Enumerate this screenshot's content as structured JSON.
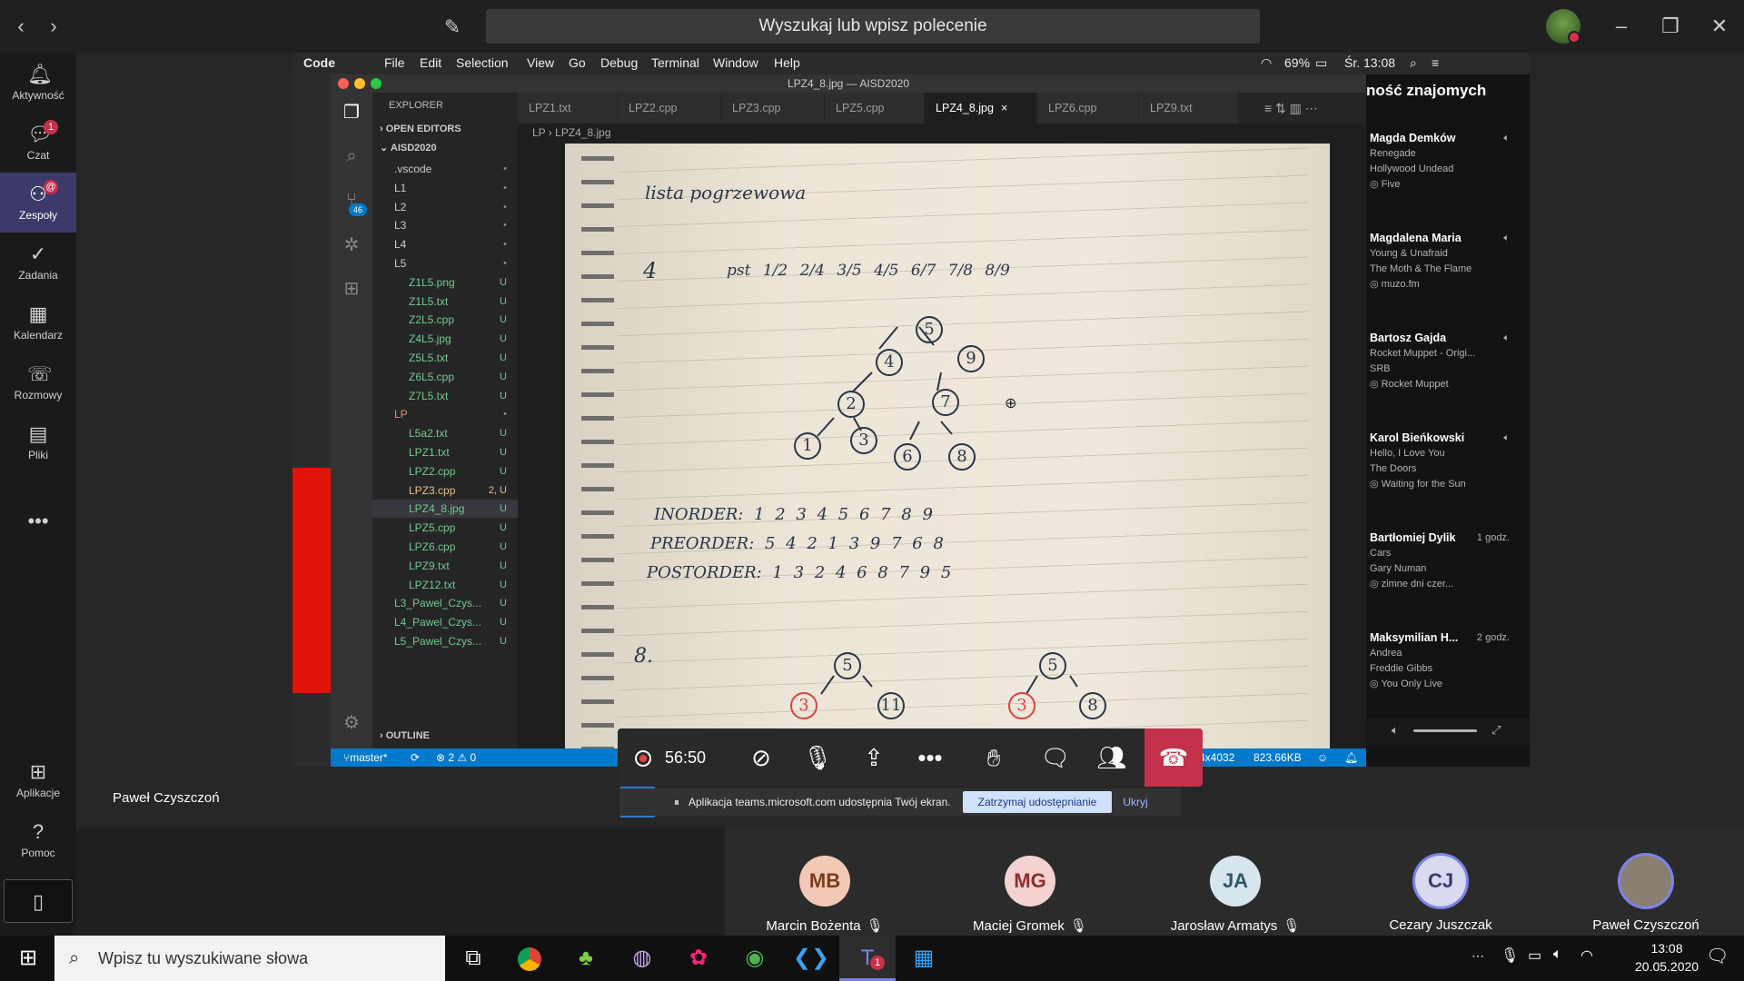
{
  "teams": {
    "search_placeholder": "Wyszukaj lub wpisz polecenie",
    "rail": [
      {
        "label": "Aktywność",
        "icon": "bell-icon"
      },
      {
        "label": "Czat",
        "icon": "chat-icon",
        "badge": "1"
      },
      {
        "label": "Zespoły",
        "icon": "teams-icon",
        "badge": "@"
      },
      {
        "label": "Zadania",
        "icon": "tasks-icon"
      },
      {
        "label": "Kalendarz",
        "icon": "calendar-icon"
      },
      {
        "label": "Rozmowy",
        "icon": "phone-icon"
      },
      {
        "label": "Pliki",
        "icon": "files-icon"
      },
      {
        "label": "Aplikacje",
        "icon": "apps-icon"
      },
      {
        "label": "Pomoc",
        "icon": "help-icon"
      }
    ]
  },
  "mac_menu": {
    "items": [
      "Code",
      "File",
      "Edit",
      "Selection",
      "View",
      "Go",
      "Debug",
      "Terminal",
      "Window",
      "Help"
    ],
    "battery": "69%",
    "clock": "Śr. 13:08"
  },
  "vscode": {
    "window_title": "LPZ4_8.jpg — AISD2020",
    "explorer_title": "EXPLORER",
    "open_editors": "OPEN EDITORS",
    "project": "AISD2020",
    "outline": "OUTLINE",
    "scm_badge": "46",
    "tree": [
      {
        "name": ".vscode",
        "status": "•",
        "indent": 1
      },
      {
        "name": "L1",
        "status": "•",
        "indent": 1
      },
      {
        "name": "L2",
        "status": "•",
        "indent": 1
      },
      {
        "name": "L3",
        "status": "•",
        "indent": 1
      },
      {
        "name": "L4",
        "status": "•",
        "indent": 1
      },
      {
        "name": "L5",
        "status": "•",
        "indent": 1
      },
      {
        "name": "Z1L5.png",
        "status": "U",
        "indent": 2
      },
      {
        "name": "Z1L5.txt",
        "status": "U",
        "indent": 2
      },
      {
        "name": "Z2L5.cpp",
        "status": "U",
        "indent": 2
      },
      {
        "name": "Z4L5.jpg",
        "status": "U",
        "indent": 2
      },
      {
        "name": "Z5L5.txt",
        "status": "U",
        "indent": 2
      },
      {
        "name": "Z6L5.cpp",
        "status": "U",
        "indent": 2
      },
      {
        "name": "Z7L5.txt",
        "status": "U",
        "indent": 2
      },
      {
        "name": "LP",
        "status": "•",
        "indent": 1
      },
      {
        "name": "L5a2.txt",
        "status": "U",
        "indent": 2
      },
      {
        "name": "LPZ1.txt",
        "status": "U",
        "indent": 2
      },
      {
        "name": "LPZ2.cpp",
        "status": "U",
        "indent": 2
      },
      {
        "name": "LPZ3.cpp",
        "status": "2, U",
        "indent": 2
      },
      {
        "name": "LPZ4_8.jpg",
        "status": "U",
        "indent": 2
      },
      {
        "name": "LPZ5.cpp",
        "status": "U",
        "indent": 2
      },
      {
        "name": "LPZ6.cpp",
        "status": "U",
        "indent": 2
      },
      {
        "name": "LPZ9.txt",
        "status": "U",
        "indent": 2
      },
      {
        "name": "LPZ12.txt",
        "status": "U",
        "indent": 2
      },
      {
        "name": "L3_Pawel_Czys...",
        "status": "U",
        "indent": 1
      },
      {
        "name": "L4_Pawel_Czys...",
        "status": "U",
        "indent": 1
      },
      {
        "name": "L5_Pawel_Czys...",
        "status": "U",
        "indent": 1
      }
    ],
    "tabs": [
      "LPZ1.txt",
      "LPZ2.cpp",
      "LPZ3.cpp",
      "LPZ5.cpp",
      "LPZ4_8.jpg",
      "LPZ6.cpp",
      "LPZ9.txt"
    ],
    "breadcrumb": [
      "LP",
      "LPZ4_8.jpg"
    ],
    "status": {
      "branch": "master*",
      "problems": "⊗ 2 ⚠ 0",
      "dims": "4x4032",
      "size": "823.66KB"
    }
  },
  "notes": {
    "title": "lista pogrzewowa",
    "label4": "4",
    "row4": "pst  1/2  2/4  3/5  4/5  6/7  7/8  8/9",
    "inorder": "INORDER:   1 2 3 4 5 6 7 8 9",
    "preorder": "PREORDER:   5 4 2 1 3 9 7 6 8",
    "postorder": "POSTORDER:   1 3 2 4 6 8 7 9 5",
    "label8": "8.",
    "tree_nodes": [
      "5",
      "4",
      "9",
      "2",
      "7",
      "1",
      "3",
      "6",
      "8"
    ],
    "tree2_nodes": [
      "5",
      "3",
      "11"
    ],
    "tree3_nodes": [
      "5",
      "3",
      "8"
    ]
  },
  "spotify": {
    "title": "ność znajomych",
    "friends": [
      {
        "name": "Magda Demków",
        "song": "Renegade",
        "artist": "Hollywood Undead",
        "ctx": "Five",
        "time": ""
      },
      {
        "name": "Magdalena Maria",
        "song": "Young & Unafraid",
        "artist": "The Moth & The Flame",
        "ctx": "muzo.fm",
        "time": ""
      },
      {
        "name": "Bartosz Gajda",
        "song": "Rocket Muppet - Origi...",
        "artist": "SRB",
        "ctx": "Rocket Muppet",
        "time": ""
      },
      {
        "name": "Karol Bieńkowski",
        "song": "Hello, I Love You",
        "artist": "The Doors",
        "ctx": "Waiting for the Sun",
        "time": ""
      },
      {
        "name": "Bartłomiej Dylik",
        "song": "Cars",
        "artist": "Gary Numan",
        "ctx": "zimne dni czer...",
        "time": "1 godz."
      },
      {
        "name": "Maksymilian H...",
        "song": "Andrea",
        "artist": "Freddie Gibbs",
        "ctx": "You Only Live",
        "time": "2 godz."
      }
    ]
  },
  "call": {
    "timer": "56:50",
    "share_text": "Aplikacja teams.microsoft.com udostępnia Twój ekran.",
    "stop_share": "Zatrzymaj udostępnianie",
    "hide": "Ukryj",
    "presenter": "Paweł Czyszczoń",
    "participants": [
      {
        "initials": "MB",
        "name": "Marcin Bożenta",
        "color": "#f1c9b4",
        "text": "#7a3d1e"
      },
      {
        "initials": "MG",
        "name": "Maciej Gromek",
        "color": "#f4d2d2",
        "text": "#8c2f2f"
      },
      {
        "initials": "JA",
        "name": "Jarosław Armatys",
        "color": "#d7e6ee",
        "text": "#2f5768"
      },
      {
        "initials": "CJ",
        "name": "Cezary Juszczak",
        "color": "#d9d9ef",
        "text": "#3b3a6a"
      },
      {
        "initials": "",
        "name": "Paweł Czyszczoń",
        "color": "#8a7f70",
        "text": "#fff"
      }
    ]
  },
  "taskbar": {
    "search_placeholder": "Wpisz tu wyszukiwane słowa",
    "time": "13:08",
    "date": "20.05.2020"
  }
}
